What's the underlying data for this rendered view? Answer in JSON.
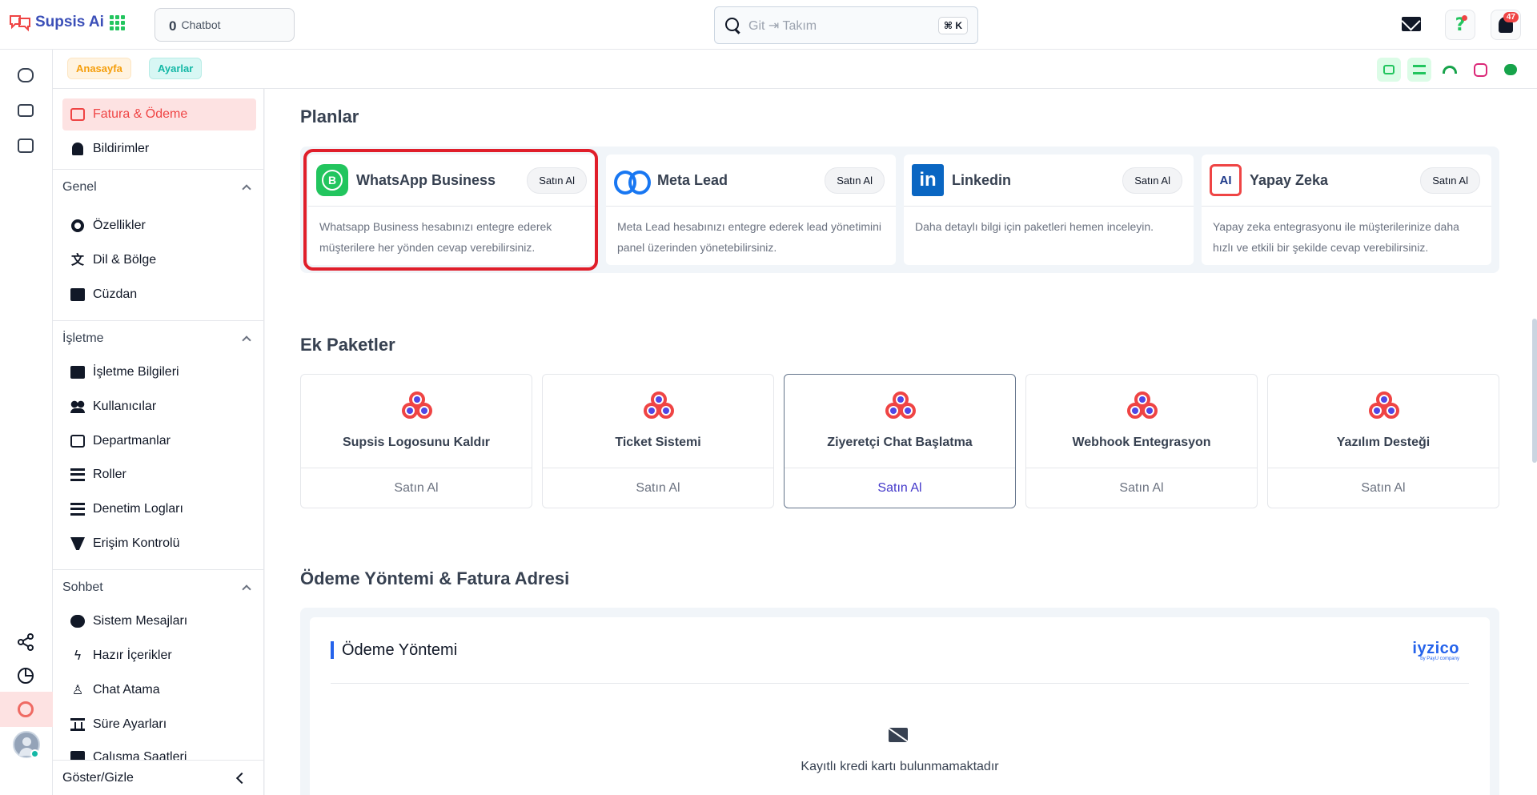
{
  "app": {
    "name": "Supsis Ai"
  },
  "topbar": {
    "chatbot_count": "0",
    "chatbot_label": "Chatbot",
    "search_placeholder": "Git ⇥ Takım",
    "search_shortcut": "⌘ K",
    "notification_count": "47",
    "accent_color": "#ef4444"
  },
  "breadcrumb": {
    "home": "Anasayfa",
    "settings": "Ayarlar"
  },
  "sidebar": {
    "top_items": [
      {
        "label": "Fatura & Ödeme",
        "icon": "invoice-icon",
        "active": true
      },
      {
        "label": "Bildirimler",
        "icon": "bell-icon"
      }
    ],
    "sections": [
      {
        "title": "Genel",
        "items": [
          {
            "label": "Özellikler",
            "icon": "gear-icon"
          },
          {
            "label": "Dil & Bölge",
            "icon": "translate-icon"
          },
          {
            "label": "Cüzdan",
            "icon": "wallet-icon"
          }
        ]
      },
      {
        "title": "İşletme",
        "items": [
          {
            "label": "İşletme Bilgileri",
            "icon": "building-icon"
          },
          {
            "label": "Kullanıcılar",
            "icon": "users-icon"
          },
          {
            "label": "Departmanlar",
            "icon": "department-icon"
          },
          {
            "label": "Roller",
            "icon": "roles-icon"
          },
          {
            "label": "Denetim Logları",
            "icon": "logs-icon"
          },
          {
            "label": "Erişim Kontrolü",
            "icon": "access-icon"
          }
        ]
      },
      {
        "title": "Sohbet",
        "items": [
          {
            "label": "Sistem Mesajları",
            "icon": "wave-icon"
          },
          {
            "label": "Hazır İçerikler",
            "icon": "bolt-icon"
          },
          {
            "label": "Chat Atama",
            "icon": "assign-icon"
          },
          {
            "label": "Süre Ayarları",
            "icon": "hourglass-icon"
          },
          {
            "label": "Çalışma Saatleri",
            "icon": "calendar-icon"
          }
        ]
      }
    ],
    "footer_label": "Göster/Gizle"
  },
  "plans": {
    "title": "Planlar",
    "items": [
      {
        "title": "WhatsApp Business",
        "button": "Satın Al",
        "description": "Whatsapp Business hesabınızı entegre ederek müşterilere her yönden cevap verebilirsiniz.",
        "icon": "whatsapp-icon"
      },
      {
        "title": "Meta Lead",
        "button": "Satın Al",
        "description": "Meta Lead hesabınızı entegre ederek lead yönetimini panel üzerinden yönetebilirsiniz.",
        "icon": "meta-icon"
      },
      {
        "title": "Linkedin",
        "button": "Satın Al",
        "description": "Daha detaylı bilgi için paketleri hemen inceleyin.",
        "icon": "linkedin-icon"
      },
      {
        "title": "Yapay Zeka",
        "button": "Satın Al",
        "description": "Yapay zeka entegrasyonu ile müşterilerinize daha hızlı ve etkili bir şekilde cevap verebilirsiniz.",
        "icon": "ai-chip-icon"
      }
    ]
  },
  "packages": {
    "title": "Ek Paketler",
    "items": [
      {
        "title": "Supsis Logosunu Kaldır",
        "button": "Satın Al"
      },
      {
        "title": "Ticket Sistemi",
        "button": "Satın Al"
      },
      {
        "title": "Ziyeretçi Chat Başlatma",
        "button": "Satın Al"
      },
      {
        "title": "Webhook Entegrasyon",
        "button": "Satın Al"
      },
      {
        "title": "Yazılım Desteği",
        "button": "Satın Al"
      }
    ]
  },
  "payment": {
    "section_title": "Ödeme Yöntemi & Fatura Adresi",
    "card_title": "Ödeme Yöntemi",
    "provider": "iyzico",
    "provider_sub": "by PayU company",
    "empty_text": "Kayıtlı kredi kartı bulunmamaktadır"
  }
}
